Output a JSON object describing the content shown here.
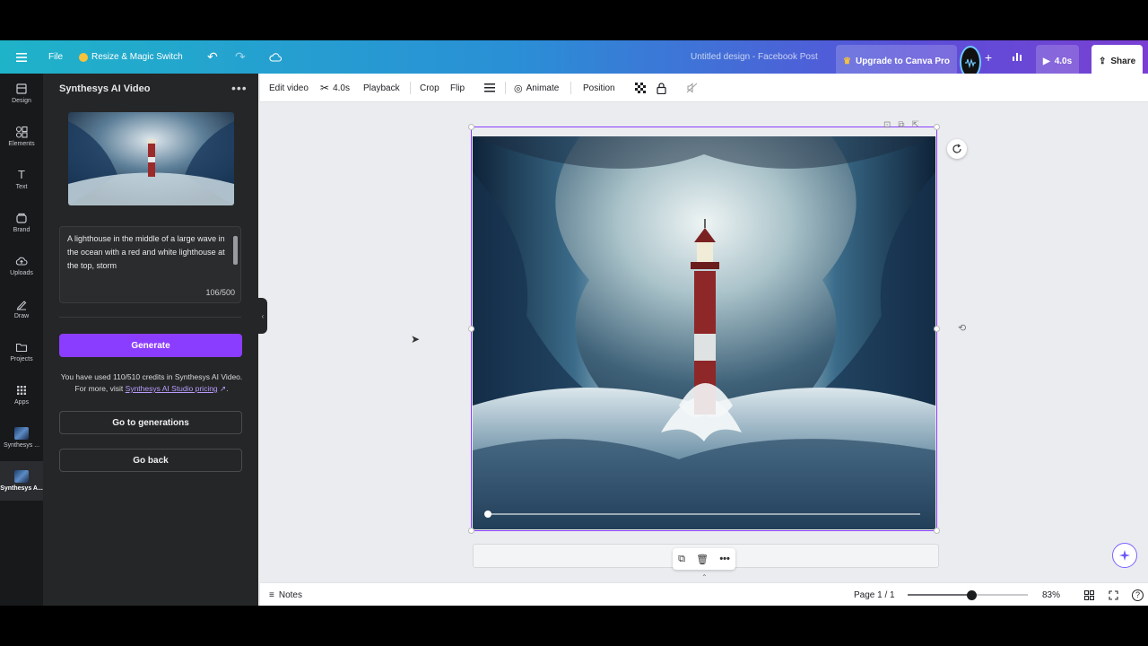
{
  "topbar": {
    "file": "File",
    "resize": "Resize & Magic Switch",
    "title": "Untitled design - Facebook Post",
    "upgrade": "Upgrade to Canva Pro",
    "play_duration": "4.0s",
    "share": "Share"
  },
  "rail": [
    {
      "label": "Design",
      "icon": "layout-icon"
    },
    {
      "label": "Elements",
      "icon": "shapes-icon"
    },
    {
      "label": "Text",
      "icon": "text-icon"
    },
    {
      "label": "Brand",
      "icon": "brand-icon"
    },
    {
      "label": "Uploads",
      "icon": "upload-cloud-icon"
    },
    {
      "label": "Draw",
      "icon": "pen-icon"
    },
    {
      "label": "Projects",
      "icon": "folder-icon"
    },
    {
      "label": "Apps",
      "icon": "grid-icon"
    },
    {
      "label": "Synthesys ...",
      "icon": "app-thumb"
    },
    {
      "label": "Synthesys A...",
      "icon": "app-thumb"
    }
  ],
  "panel": {
    "title": "Synthesys AI Video",
    "prompt": "A lighthouse in the middle of a large wave in the ocean with a red and white lighthouse at the top, storm",
    "char_count": "106/500",
    "generate": "Generate",
    "credits_text": "You have used 110/510 credits in Synthesys AI Video. For more, visit ",
    "credits_link": "Synthesys AI Studio pricing",
    "credits_end": ".",
    "go_generations": "Go to generations",
    "go_back": "Go back"
  },
  "toolbar": {
    "edit_video": "Edit video",
    "duration": "4.0s",
    "playback": "Playback",
    "crop": "Crop",
    "flip": "Flip",
    "animate": "Animate",
    "position": "Position"
  },
  "footer": {
    "notes": "Notes",
    "page": "Page 1 / 1",
    "zoom": "83%",
    "zoom_level": 0.53
  },
  "video": {
    "progress": 0.02
  },
  "colors": {
    "accent": "#8b3dff",
    "panel_bg": "#252627",
    "rail_bg": "#18191b"
  }
}
